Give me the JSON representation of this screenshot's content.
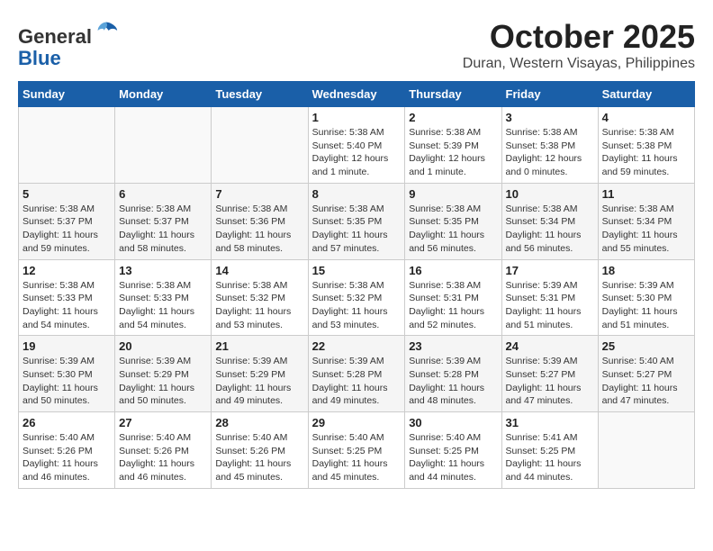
{
  "header": {
    "logo_line1": "General",
    "logo_line2": "Blue",
    "month": "October 2025",
    "location": "Duran, Western Visayas, Philippines"
  },
  "weekdays": [
    "Sunday",
    "Monday",
    "Tuesday",
    "Wednesday",
    "Thursday",
    "Friday",
    "Saturday"
  ],
  "weeks": [
    [
      {
        "day": "",
        "info": ""
      },
      {
        "day": "",
        "info": ""
      },
      {
        "day": "",
        "info": ""
      },
      {
        "day": "1",
        "info": "Sunrise: 5:38 AM\nSunset: 5:40 PM\nDaylight: 12 hours\nand 1 minute."
      },
      {
        "day": "2",
        "info": "Sunrise: 5:38 AM\nSunset: 5:39 PM\nDaylight: 12 hours\nand 1 minute."
      },
      {
        "day": "3",
        "info": "Sunrise: 5:38 AM\nSunset: 5:38 PM\nDaylight: 12 hours\nand 0 minutes."
      },
      {
        "day": "4",
        "info": "Sunrise: 5:38 AM\nSunset: 5:38 PM\nDaylight: 11 hours\nand 59 minutes."
      }
    ],
    [
      {
        "day": "5",
        "info": "Sunrise: 5:38 AM\nSunset: 5:37 PM\nDaylight: 11 hours\nand 59 minutes."
      },
      {
        "day": "6",
        "info": "Sunrise: 5:38 AM\nSunset: 5:37 PM\nDaylight: 11 hours\nand 58 minutes."
      },
      {
        "day": "7",
        "info": "Sunrise: 5:38 AM\nSunset: 5:36 PM\nDaylight: 11 hours\nand 58 minutes."
      },
      {
        "day": "8",
        "info": "Sunrise: 5:38 AM\nSunset: 5:35 PM\nDaylight: 11 hours\nand 57 minutes."
      },
      {
        "day": "9",
        "info": "Sunrise: 5:38 AM\nSunset: 5:35 PM\nDaylight: 11 hours\nand 56 minutes."
      },
      {
        "day": "10",
        "info": "Sunrise: 5:38 AM\nSunset: 5:34 PM\nDaylight: 11 hours\nand 56 minutes."
      },
      {
        "day": "11",
        "info": "Sunrise: 5:38 AM\nSunset: 5:34 PM\nDaylight: 11 hours\nand 55 minutes."
      }
    ],
    [
      {
        "day": "12",
        "info": "Sunrise: 5:38 AM\nSunset: 5:33 PM\nDaylight: 11 hours\nand 54 minutes."
      },
      {
        "day": "13",
        "info": "Sunrise: 5:38 AM\nSunset: 5:33 PM\nDaylight: 11 hours\nand 54 minutes."
      },
      {
        "day": "14",
        "info": "Sunrise: 5:38 AM\nSunset: 5:32 PM\nDaylight: 11 hours\nand 53 minutes."
      },
      {
        "day": "15",
        "info": "Sunrise: 5:38 AM\nSunset: 5:32 PM\nDaylight: 11 hours\nand 53 minutes."
      },
      {
        "day": "16",
        "info": "Sunrise: 5:38 AM\nSunset: 5:31 PM\nDaylight: 11 hours\nand 52 minutes."
      },
      {
        "day": "17",
        "info": "Sunrise: 5:39 AM\nSunset: 5:31 PM\nDaylight: 11 hours\nand 51 minutes."
      },
      {
        "day": "18",
        "info": "Sunrise: 5:39 AM\nSunset: 5:30 PM\nDaylight: 11 hours\nand 51 minutes."
      }
    ],
    [
      {
        "day": "19",
        "info": "Sunrise: 5:39 AM\nSunset: 5:30 PM\nDaylight: 11 hours\nand 50 minutes."
      },
      {
        "day": "20",
        "info": "Sunrise: 5:39 AM\nSunset: 5:29 PM\nDaylight: 11 hours\nand 50 minutes."
      },
      {
        "day": "21",
        "info": "Sunrise: 5:39 AM\nSunset: 5:29 PM\nDaylight: 11 hours\nand 49 minutes."
      },
      {
        "day": "22",
        "info": "Sunrise: 5:39 AM\nSunset: 5:28 PM\nDaylight: 11 hours\nand 49 minutes."
      },
      {
        "day": "23",
        "info": "Sunrise: 5:39 AM\nSunset: 5:28 PM\nDaylight: 11 hours\nand 48 minutes."
      },
      {
        "day": "24",
        "info": "Sunrise: 5:39 AM\nSunset: 5:27 PM\nDaylight: 11 hours\nand 47 minutes."
      },
      {
        "day": "25",
        "info": "Sunrise: 5:40 AM\nSunset: 5:27 PM\nDaylight: 11 hours\nand 47 minutes."
      }
    ],
    [
      {
        "day": "26",
        "info": "Sunrise: 5:40 AM\nSunset: 5:26 PM\nDaylight: 11 hours\nand 46 minutes."
      },
      {
        "day": "27",
        "info": "Sunrise: 5:40 AM\nSunset: 5:26 PM\nDaylight: 11 hours\nand 46 minutes."
      },
      {
        "day": "28",
        "info": "Sunrise: 5:40 AM\nSunset: 5:26 PM\nDaylight: 11 hours\nand 45 minutes."
      },
      {
        "day": "29",
        "info": "Sunrise: 5:40 AM\nSunset: 5:25 PM\nDaylight: 11 hours\nand 45 minutes."
      },
      {
        "day": "30",
        "info": "Sunrise: 5:40 AM\nSunset: 5:25 PM\nDaylight: 11 hours\nand 44 minutes."
      },
      {
        "day": "31",
        "info": "Sunrise: 5:41 AM\nSunset: 5:25 PM\nDaylight: 11 hours\nand 44 minutes."
      },
      {
        "day": "",
        "info": ""
      }
    ]
  ]
}
